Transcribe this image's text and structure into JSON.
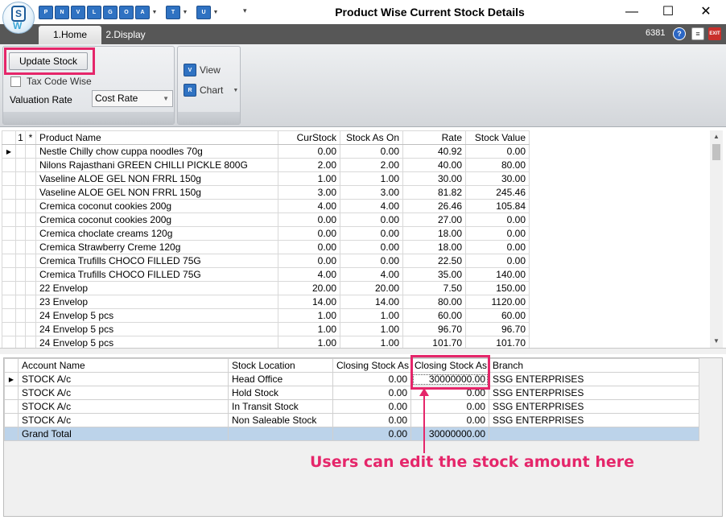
{
  "window": {
    "title": "Product Wise Current Stock Details",
    "minimize": "—",
    "maximize": "☐",
    "close": "✕"
  },
  "quick_access": [
    {
      "label": "P",
      "icon": "report-p-icon"
    },
    {
      "label": "N",
      "icon": "report-n-icon"
    },
    {
      "label": "V",
      "icon": "report-v-icon"
    },
    {
      "label": "L",
      "icon": "report-l-icon"
    },
    {
      "label": "G",
      "icon": "report-g-icon"
    },
    {
      "label": "O",
      "icon": "report-o-icon"
    },
    {
      "label": "A",
      "icon": "report-a-icon"
    },
    {
      "label": "T",
      "icon": "report-t-icon"
    },
    {
      "label": "U",
      "icon": "report-u-icon"
    }
  ],
  "tabs": {
    "home": "1.Home",
    "display": "2.Display",
    "counter": "6381"
  },
  "ribbon": {
    "update_stock": "Update Stock",
    "tax_code_wise": "Tax Code Wise",
    "valuation_rate_label": "Valuation Rate",
    "valuation_rate_value": "Cost Rate",
    "view": "View",
    "chart": "Chart"
  },
  "products": {
    "headers": {
      "col1": "1",
      "col2": "*",
      "name": "Product Name",
      "cur": "CurStock",
      "ason": "Stock As On",
      "rate": "Rate",
      "value": "Stock Value"
    },
    "rows": [
      {
        "name": "Nestle Chilly chow cuppa noodles 70g",
        "cur": "0.00",
        "ason": "0.00",
        "rate": "40.92",
        "value": "0.00"
      },
      {
        "name": "Nilons Rajasthani GREEN CHILLI PICKLE 800G",
        "cur": "2.00",
        "ason": "2.00",
        "rate": "40.00",
        "value": "80.00"
      },
      {
        "name": "Vaseline ALOE GEL NON  FRRL 150g",
        "cur": "1.00",
        "ason": "1.00",
        "rate": "30.00",
        "value": "30.00"
      },
      {
        "name": "Vaseline ALOE GEL NON  FRRL 150g",
        "cur": "3.00",
        "ason": "3.00",
        "rate": "81.82",
        "value": "245.46"
      },
      {
        "name": "Cremica coconut cookies 200g",
        "cur": "4.00",
        "ason": "4.00",
        "rate": "26.46",
        "value": "105.84"
      },
      {
        "name": "Cremica coconut cookies 200g",
        "cur": "0.00",
        "ason": "0.00",
        "rate": "27.00",
        "value": "0.00"
      },
      {
        "name": "Cremica choclate creams 120g",
        "cur": "0.00",
        "ason": "0.00",
        "rate": "18.00",
        "value": "0.00"
      },
      {
        "name": "Cremica Strawberry Creme 120g",
        "cur": "0.00",
        "ason": "0.00",
        "rate": "18.00",
        "value": "0.00"
      },
      {
        "name": "Cremica Trufills CHOCO FILLED 75G",
        "cur": "0.00",
        "ason": "0.00",
        "rate": "22.50",
        "value": "0.00"
      },
      {
        "name": "Cremica Trufills CHOCO FILLED 75G",
        "cur": "4.00",
        "ason": "4.00",
        "rate": "35.00",
        "value": "140.00"
      },
      {
        "name": "22 Envelop",
        "cur": "20.00",
        "ason": "20.00",
        "rate": "7.50",
        "value": "150.00"
      },
      {
        "name": "23 Envelop",
        "cur": "14.00",
        "ason": "14.00",
        "rate": "80.00",
        "value": "1120.00"
      },
      {
        "name": "24 Envelop 5 pcs",
        "cur": "1.00",
        "ason": "1.00",
        "rate": "60.00",
        "value": "60.00"
      },
      {
        "name": "24 Envelop 5 pcs",
        "cur": "1.00",
        "ason": "1.00",
        "rate": "96.70",
        "value": "96.70"
      },
      {
        "name": "24 Envelop 5 pcs",
        "cur": "1.00",
        "ason": "1.00",
        "rate": "101.70",
        "value": "101.70"
      }
    ]
  },
  "accounts": {
    "headers": {
      "account": "Account Name",
      "location": "Stock Location",
      "closing1": "Closing Stock As",
      "closing2": "Closing Stock As",
      "branch": "Branch"
    },
    "rows": [
      {
        "account": "STOCK A/c",
        "location": "Head Office",
        "closing1": "0.00",
        "closing2": "30000000.00",
        "branch": "SSG ENTERPRISES"
      },
      {
        "account": "STOCK A/c",
        "location": "Hold Stock",
        "closing1": "0.00",
        "closing2": "0.00",
        "branch": "SSG ENTERPRISES"
      },
      {
        "account": "STOCK A/c",
        "location": "In Transit Stock",
        "closing1": "0.00",
        "closing2": "0.00",
        "branch": "SSG ENTERPRISES"
      },
      {
        "account": "STOCK A/c",
        "location": "Non Saleable Stock",
        "closing1": "0.00",
        "closing2": "0.00",
        "branch": "SSG ENTERPRISES"
      }
    ],
    "total": {
      "account": "Grand Total",
      "location": "",
      "closing1": "0.00",
      "closing2": "30000000.00",
      "branch": ""
    }
  },
  "annotation": {
    "callout": "Users can edit the stock amount here",
    "highlight_color": "#e5266a"
  }
}
